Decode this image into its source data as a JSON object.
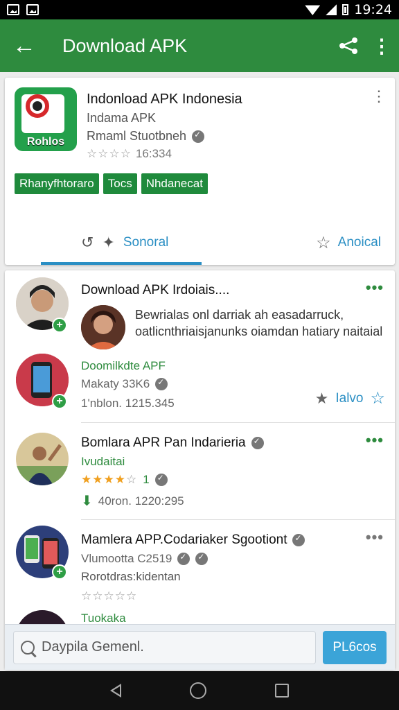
{
  "status_bar": {
    "time": "19:24"
  },
  "app_bar": {
    "title": "Download APK",
    "back_icon": "arrow-back-icon",
    "share_icon": "share-icon",
    "more_icon": "more-vert-icon"
  },
  "featured": {
    "icon_label": "Rohlos",
    "title": "Indonload APK Indonesia",
    "subtitle": "Indama APK",
    "developer": "Rmaml Stuotbneh",
    "rating_text": "16:334",
    "tags": [
      "Rhanyfhtoraro",
      "Tocs",
      "Nhdanecat"
    ],
    "action_left": "Sonoral",
    "action_right": "Anoical"
  },
  "list": [
    {
      "title": "Download APK Irdoiais....",
      "description": "Bewrialas onl darriak ah easadarruck, oatlicnthriaisjanunks oiamdan hatiary naitaial",
      "line1": "Doomilkdte APF",
      "line2": "Makaty 33K6",
      "line3": "1'nblon. 1215.345",
      "action": "Ialvo"
    },
    {
      "title": "Bomlara APR Pan Indarieria",
      "line1": "Ivudaitai",
      "rating_value": "1",
      "line3": "40ron.  1220:295"
    },
    {
      "title": "Mamlera APP.Codariaker Sgootiont",
      "line1": "Vlumootta C2519",
      "line2": "Rorotdras:kidentan"
    },
    {
      "title": "Tuokaka"
    }
  ],
  "search": {
    "placeholder": "Daypila Gemenl.",
    "button": "PL6cos"
  }
}
